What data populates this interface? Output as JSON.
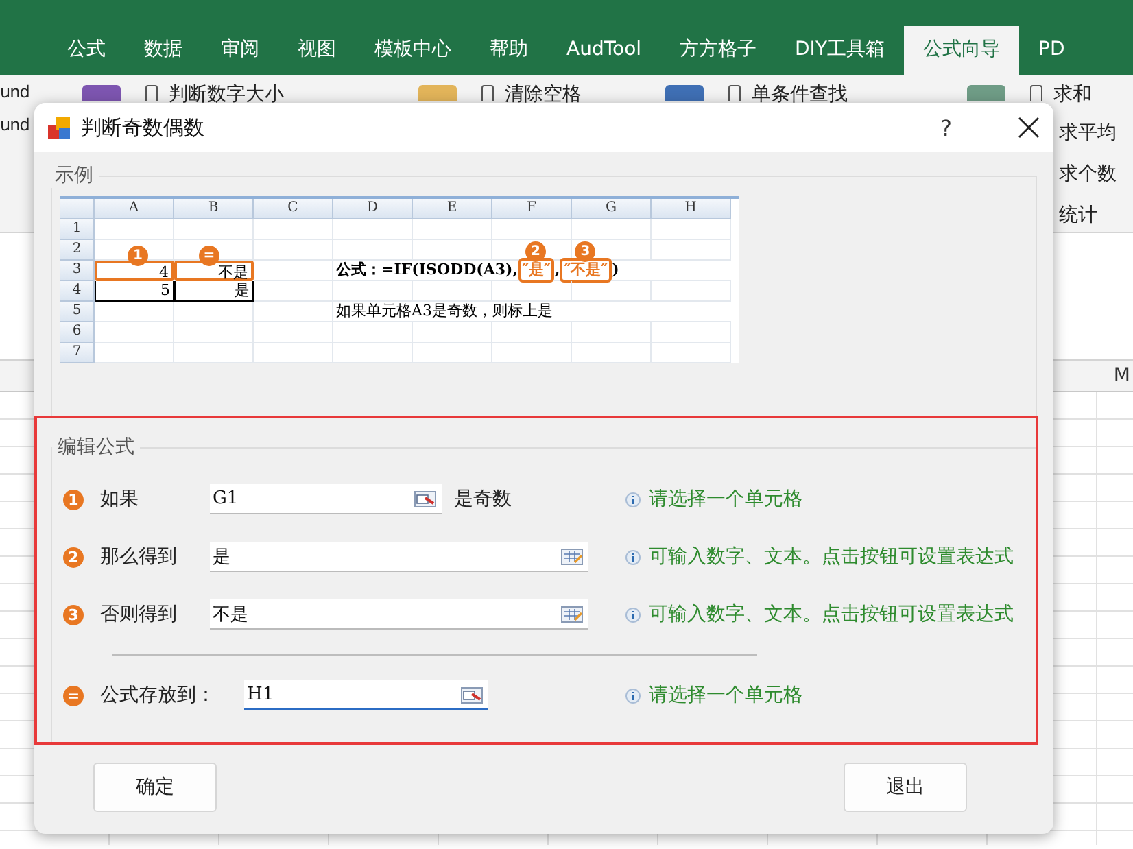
{
  "app": {
    "tabs": [
      {
        "label": "公式",
        "selected": false
      },
      {
        "label": "数据",
        "selected": false
      },
      {
        "label": "审阅",
        "selected": false
      },
      {
        "label": "视图",
        "selected": false
      },
      {
        "label": "模板中心",
        "selected": false
      },
      {
        "label": "帮助",
        "selected": false
      },
      {
        "label": "AudTool",
        "selected": false
      },
      {
        "label": "方方格子",
        "selected": false
      },
      {
        "label": "DIY工具箱",
        "selected": false
      },
      {
        "label": "公式向导",
        "selected": true
      },
      {
        "label": "PD",
        "selected": false
      }
    ],
    "ribbon_left": [
      "und",
      "und"
    ],
    "ribbon_groups": [
      {
        "label": "判断数字大小",
        "color": "#7d55b0"
      },
      {
        "label": "清除空格",
        "color": "#e2b45a"
      },
      {
        "label": "单条件查找",
        "color": "#3f6fb4"
      },
      {
        "label": "求和",
        "color": "#6f9c86"
      }
    ],
    "ribbon_right": [
      "求平均",
      "求个数",
      "统计"
    ],
    "column_header": "M"
  },
  "dialog": {
    "title": "判断奇数偶数",
    "help": "?",
    "example": {
      "legend": "示例",
      "columns": [
        "A",
        "B",
        "C",
        "D",
        "E",
        "F",
        "G",
        "H"
      ],
      "rows": [
        {
          "header": "1"
        },
        {
          "header": "2"
        },
        {
          "header": "3",
          "cells": [
            {
              "text": "4",
              "boxed": true,
              "badge": "1"
            },
            {
              "text": "不是",
              "boxed": true,
              "badge": "="
            }
          ],
          "formula": [
            {
              "text": "公式：=IF(ISODD(A3),",
              "highlight": false
            },
            {
              "text": "″是″",
              "highlight": true,
              "badge": "2"
            },
            {
              "text": ",",
              "highlight": false
            },
            {
              "text": "″不是″",
              "highlight": true,
              "badge": "3"
            },
            {
              "text": ")",
              "highlight": false
            }
          ]
        },
        {
          "header": "4",
          "cells": [
            {
              "text": "5",
              "boxed": false
            },
            {
              "text": "是",
              "boxed": false
            }
          ]
        },
        {
          "header": "5",
          "note": "如果单元格A3是奇数，则标上是"
        },
        {
          "header": "6"
        },
        {
          "header": "7"
        }
      ]
    },
    "editor": {
      "legend": "编辑公式",
      "rows": [
        {
          "marker": "1",
          "label": "如果",
          "value": "G1",
          "kind": "cell",
          "suffix": "是奇数",
          "hint": "请选择一个单元格",
          "wide": false,
          "focused": false
        },
        {
          "marker": "2",
          "label": "那么得到",
          "value": "是",
          "kind": "expression",
          "hint": "可输入数字、文本。点击按钮可设置表达式",
          "wide": true,
          "focused": false
        },
        {
          "marker": "3",
          "label": "否则得到",
          "value": "不是",
          "kind": "expression",
          "hint": "可输入数字、文本。点击按钮可设置表达式",
          "wide": true,
          "focused": false
        },
        {
          "marker": "=",
          "label": "公式存放到：",
          "value": "H1",
          "kind": "cell",
          "hint": "请选择一个单元格",
          "wide": false,
          "focused": true,
          "separated": true
        }
      ]
    },
    "buttons": [
      "确定",
      "退出"
    ]
  }
}
